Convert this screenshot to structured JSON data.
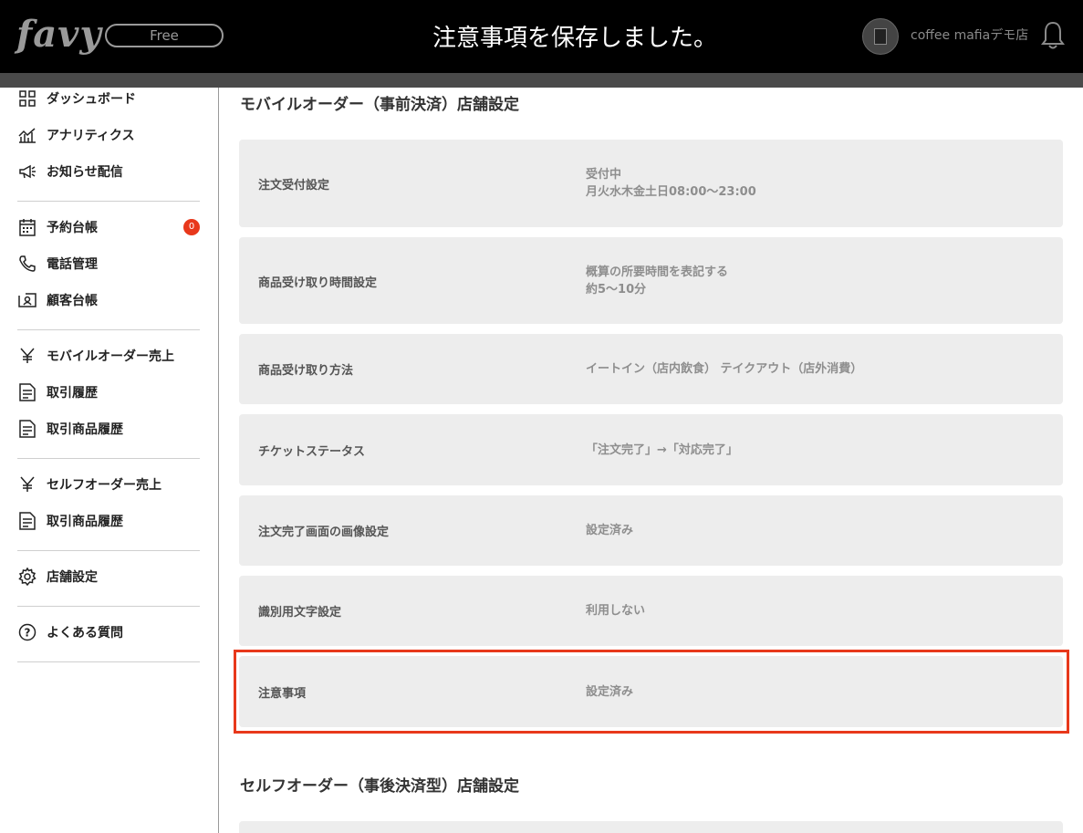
{
  "header": {
    "logo": "favy",
    "plan": "Free",
    "toast": "注意事項を保存しました。",
    "store_name": "coffee mafiaデモ店"
  },
  "sidebar": {
    "items": [
      {
        "label": "ダッシュボード",
        "icon": "dashboard-grid-icon"
      },
      {
        "label": "アナリティクス",
        "icon": "analytics-chart-icon"
      },
      {
        "label": "お知らせ配信",
        "icon": "megaphone-icon"
      },
      {
        "label": "予約台帳",
        "icon": "calendar-icon",
        "badge": "0"
      },
      {
        "label": "電話管理",
        "icon": "phone-icon"
      },
      {
        "label": "顧客台帳",
        "icon": "contact-card-icon"
      },
      {
        "label": "モバイルオーダー売上",
        "icon": "yen-icon"
      },
      {
        "label": "取引履歴",
        "icon": "document-icon"
      },
      {
        "label": "取引商品履歴",
        "icon": "document-icon"
      },
      {
        "label": "セルフオーダー売上",
        "icon": "yen-icon"
      },
      {
        "label": "取引商品履歴",
        "icon": "document-icon"
      },
      {
        "label": "店舗設定",
        "icon": "gear-icon"
      },
      {
        "label": "よくある質問",
        "icon": "help-circle-icon"
      }
    ]
  },
  "main": {
    "mobile_title": "モバイルオーダー（事前決済）店舗設定",
    "self_title": "セルフオーダー（事後決済型）店舗設定",
    "settings": [
      {
        "name": "注文受付設定",
        "value1": "受付中",
        "value2": "月火水木金土日08:00〜23:00"
      },
      {
        "name": "商品受け取り時間設定",
        "value1": "概算の所要時間を表記する",
        "value2": "約5〜10分"
      },
      {
        "name": "商品受け取り方法",
        "value1": "イートイン（店内飲食） テイクアウト（店外消費）"
      },
      {
        "name": "チケットステータス",
        "value1": "「注文完了」→「対応完了」"
      },
      {
        "name": "注文完了画面の画像設定",
        "value1": "設定済み"
      },
      {
        "name": "識別用文字設定",
        "value1": "利用しない"
      },
      {
        "name": "注意事項",
        "value1": "設定済み"
      }
    ]
  },
  "colors": {
    "header_bg": "#000000",
    "accent": "#e8381b",
    "row_bg": "#ededed"
  }
}
